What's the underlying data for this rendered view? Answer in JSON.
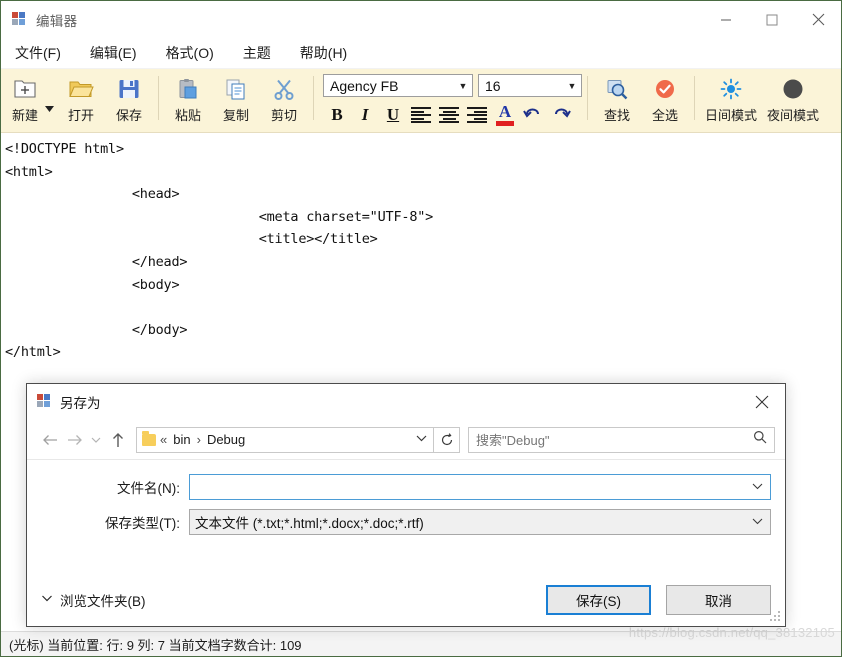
{
  "window": {
    "title": "编辑器",
    "icon": "app-icon",
    "controls": {
      "minimize": "minimize-icon",
      "maximize": "maximize-icon",
      "close": "close-icon"
    }
  },
  "menubar": {
    "items": [
      {
        "label": "文件(F)",
        "name": "menu-file"
      },
      {
        "label": "编辑(E)",
        "name": "menu-edit"
      },
      {
        "label": "格式(O)",
        "name": "menu-format"
      },
      {
        "label": "主题",
        "name": "menu-theme"
      },
      {
        "label": "帮助(H)",
        "name": "menu-help"
      }
    ]
  },
  "toolbar": {
    "file_group": [
      {
        "label": "新建",
        "icon": "new-file-icon",
        "has_dropdown": true
      },
      {
        "label": "打开",
        "icon": "open-folder-icon",
        "has_dropdown": false
      },
      {
        "label": "保存",
        "icon": "save-disk-icon",
        "has_dropdown": false
      }
    ],
    "clipboard_group": [
      {
        "label": "粘贴",
        "icon": "paste-icon"
      },
      {
        "label": "复制",
        "icon": "copy-icon"
      },
      {
        "label": "剪切",
        "icon": "scissors-icon"
      }
    ],
    "font_name": "Agency FB",
    "font_size": "16",
    "format_buttons": [
      {
        "label": "B",
        "name": "bold-button"
      },
      {
        "label": "I",
        "name": "italic-button"
      },
      {
        "label": "U",
        "name": "underline-button"
      }
    ],
    "align_buttons": [
      "align-left-icon",
      "align-center-icon",
      "align-right-icon"
    ],
    "font_color": {
      "letter": "A",
      "color": "#1f35a8",
      "bar_color": "#e02020"
    },
    "undo_label": "undo-icon",
    "redo_label": "redo-icon",
    "action_group": [
      {
        "label": "查找",
        "icon": "search-magnifier-icon"
      },
      {
        "label": "全选",
        "icon": "select-all-check-icon"
      }
    ],
    "theme_group": [
      {
        "label": "日间模式",
        "icon": "sun-icon"
      },
      {
        "label": "夜间模式",
        "icon": "moon-icon"
      }
    ],
    "colors": {
      "background": "#fbf4d8",
      "separator": "#ded5b7"
    }
  },
  "editor": {
    "content": "<!DOCTYPE html>\n<html>\n\t\t<head>\n\t\t\t\t<meta charset=\"UTF-8\">\n\t\t\t\t<title></title>\n\t\t</head>\n\t\t<body>\n\n\t\t</body>\n</html>"
  },
  "statusbar": {
    "text": "(光标) 当前位置: 行: 9 列: 7 当前文档字数合计: 109"
  },
  "watermark": {
    "text": "https://blog.csdn.net/qq_38132105"
  },
  "dialog": {
    "title": "另存为",
    "close_icon": "close-icon",
    "nav": {
      "back": "back-arrow-icon",
      "forward": "forward-arrow-icon",
      "recent": "recent-chevron-icon",
      "up": "up-arrow-icon",
      "folder_icon": "folder-icon",
      "breadcrumbs": [
        "«",
        "bin",
        "›",
        "Debug"
      ],
      "dropdown": "chevron-down-icon",
      "refresh": "refresh-icon",
      "search_placeholder": "搜索\"Debug\"",
      "search_icon": "search-icon"
    },
    "fields": [
      {
        "label": "文件名(N):",
        "value": "",
        "type": "combo",
        "name": "filename-field"
      },
      {
        "label": "保存类型(T):",
        "value": "文本文件 (*.txt;*.html;*.docx;*.doc;*.rtf)",
        "type": "select",
        "name": "filetype-select"
      }
    ],
    "browse_label": "浏览文件夹(B)",
    "browse_chevron": "chevron-down-icon",
    "buttons": [
      {
        "label": "保存(S)",
        "name": "save-button",
        "primary": true
      },
      {
        "label": "取消",
        "name": "cancel-button",
        "primary": false
      }
    ],
    "accent_color": "#1a7fd4"
  }
}
